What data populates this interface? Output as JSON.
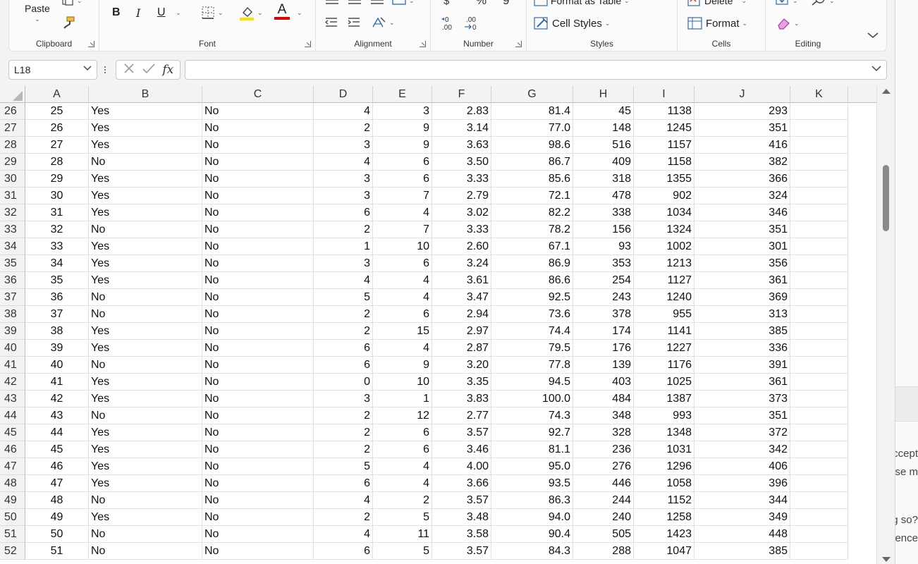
{
  "ribbon": {
    "clipboard": {
      "label": "Clipboard",
      "paste": "Paste"
    },
    "font": {
      "label": "Font",
      "bold": "B",
      "italic": "I",
      "underline": "U",
      "font_color_letter": "A"
    },
    "alignment": {
      "label": "Alignment"
    },
    "number": {
      "label": "Number",
      "inc_decimal": "←0\n.00",
      "dec_decimal": ".00\n→0"
    },
    "styles": {
      "label": "Styles",
      "format_as_table": "Format as Table",
      "cell_styles": "Cell Styles"
    },
    "cells": {
      "label": "Cells",
      "delete": "Delete",
      "format": "Format"
    },
    "editing": {
      "label": "Editing"
    },
    "colors": {
      "highlight": "#ffe100",
      "font_red": "#e00000"
    }
  },
  "formula_bar": {
    "name_box": "L18",
    "fx": "fx",
    "value": ""
  },
  "grid": {
    "columns": [
      "A",
      "B",
      "C",
      "D",
      "E",
      "F",
      "G",
      "H",
      "I",
      "J",
      "K"
    ],
    "rows": [
      {
        "n": "26",
        "cells": [
          "25",
          "Yes",
          "No",
          "4",
          "3",
          "2.83",
          "81.4",
          "45",
          "1138",
          "293"
        ]
      },
      {
        "n": "27",
        "cells": [
          "26",
          "Yes",
          "No",
          "2",
          "9",
          "3.14",
          "77.0",
          "148",
          "1245",
          "351"
        ]
      },
      {
        "n": "28",
        "cells": [
          "27",
          "Yes",
          "No",
          "3",
          "9",
          "3.63",
          "98.6",
          "516",
          "1157",
          "416"
        ]
      },
      {
        "n": "29",
        "cells": [
          "28",
          "No",
          "No",
          "4",
          "6",
          "3.50",
          "86.7",
          "409",
          "1158",
          "382"
        ]
      },
      {
        "n": "30",
        "cells": [
          "29",
          "Yes",
          "No",
          "3",
          "6",
          "3.33",
          "85.6",
          "318",
          "1355",
          "366"
        ]
      },
      {
        "n": "31",
        "cells": [
          "30",
          "Yes",
          "No",
          "3",
          "7",
          "2.79",
          "72.1",
          "478",
          "902",
          "324"
        ]
      },
      {
        "n": "32",
        "cells": [
          "31",
          "Yes",
          "No",
          "6",
          "4",
          "3.02",
          "82.2",
          "338",
          "1034",
          "346"
        ]
      },
      {
        "n": "33",
        "cells": [
          "32",
          "No",
          "No",
          "2",
          "7",
          "3.33",
          "78.2",
          "156",
          "1324",
          "351"
        ]
      },
      {
        "n": "34",
        "cells": [
          "33",
          "Yes",
          "No",
          "1",
          "10",
          "2.60",
          "67.1",
          "93",
          "1002",
          "301"
        ]
      },
      {
        "n": "35",
        "cells": [
          "34",
          "Yes",
          "No",
          "3",
          "6",
          "3.24",
          "86.9",
          "353",
          "1213",
          "356"
        ]
      },
      {
        "n": "36",
        "cells": [
          "35",
          "Yes",
          "No",
          "4",
          "4",
          "3.61",
          "86.6",
          "254",
          "1127",
          "361"
        ]
      },
      {
        "n": "37",
        "cells": [
          "36",
          "No",
          "No",
          "5",
          "4",
          "3.47",
          "92.5",
          "243",
          "1240",
          "369"
        ]
      },
      {
        "n": "38",
        "cells": [
          "37",
          "No",
          "No",
          "2",
          "6",
          "2.94",
          "73.6",
          "378",
          "955",
          "313"
        ]
      },
      {
        "n": "39",
        "cells": [
          "38",
          "Yes",
          "No",
          "2",
          "15",
          "2.97",
          "74.4",
          "174",
          "1141",
          "385"
        ]
      },
      {
        "n": "40",
        "cells": [
          "39",
          "Yes",
          "No",
          "6",
          "4",
          "2.87",
          "79.5",
          "176",
          "1227",
          "336"
        ]
      },
      {
        "n": "41",
        "cells": [
          "40",
          "No",
          "No",
          "6",
          "9",
          "3.20",
          "77.8",
          "139",
          "1176",
          "391"
        ]
      },
      {
        "n": "42",
        "cells": [
          "41",
          "Yes",
          "No",
          "0",
          "10",
          "3.35",
          "94.5",
          "403",
          "1025",
          "361"
        ]
      },
      {
        "n": "43",
        "cells": [
          "42",
          "Yes",
          "No",
          "3",
          "1",
          "3.83",
          "100.0",
          "484",
          "1387",
          "373"
        ]
      },
      {
        "n": "44",
        "cells": [
          "43",
          "No",
          "No",
          "2",
          "12",
          "2.77",
          "74.3",
          "348",
          "993",
          "351"
        ]
      },
      {
        "n": "45",
        "cells": [
          "44",
          "Yes",
          "No",
          "2",
          "6",
          "3.57",
          "92.7",
          "328",
          "1348",
          "372"
        ]
      },
      {
        "n": "46",
        "cells": [
          "45",
          "Yes",
          "No",
          "2",
          "6",
          "3.46",
          "81.1",
          "236",
          "1031",
          "342"
        ]
      },
      {
        "n": "47",
        "cells": [
          "46",
          "Yes",
          "No",
          "5",
          "4",
          "4.00",
          "95.0",
          "276",
          "1296",
          "406"
        ]
      },
      {
        "n": "48",
        "cells": [
          "47",
          "Yes",
          "No",
          "6",
          "4",
          "3.66",
          "93.5",
          "446",
          "1058",
          "396"
        ]
      },
      {
        "n": "49",
        "cells": [
          "48",
          "No",
          "No",
          "4",
          "2",
          "3.57",
          "86.3",
          "244",
          "1152",
          "344"
        ]
      },
      {
        "n": "50",
        "cells": [
          "49",
          "Yes",
          "No",
          "2",
          "5",
          "3.48",
          "94.0",
          "240",
          "1258",
          "349"
        ]
      },
      {
        "n": "51",
        "cells": [
          "50",
          "No",
          "No",
          "4",
          "11",
          "3.58",
          "90.4",
          "505",
          "1423",
          "448"
        ]
      },
      {
        "n": "52",
        "cells": [
          "51",
          "No",
          "No",
          "6",
          "5",
          "3.57",
          "84.3",
          "288",
          "1047",
          "385"
        ]
      }
    ]
  },
  "side_pane": {
    "fragments": [
      "ccept",
      "se m",
      "g so?",
      "ence"
    ]
  }
}
